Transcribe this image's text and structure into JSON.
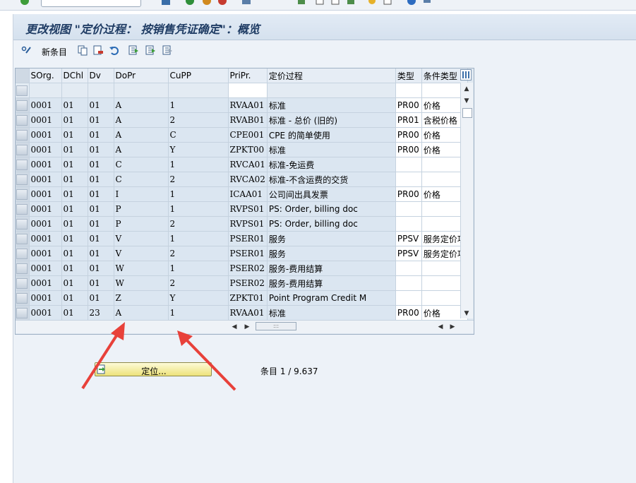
{
  "title": "更改视图 \"定价过程： 按销售凭证确定\"：概览",
  "toolbar": {
    "new_entries_label": "新条目",
    "icons": [
      "display-change-icon",
      "copy-icon",
      "delete-icon",
      "undo-icon",
      "select-all-icon",
      "select-block-icon",
      "deselect-all-icon"
    ]
  },
  "table": {
    "columns": [
      "SOrg.",
      "DChl",
      "Dv",
      "DoPr",
      "CuPP",
      "PriPr.",
      "定价过程",
      "类型",
      "条件类型"
    ],
    "rows": [
      [
        "0001",
        "01",
        "01",
        "A",
        "1",
        "RVAA01",
        "标准",
        "PR00",
        "价格"
      ],
      [
        "0001",
        "01",
        "01",
        "A",
        "2",
        "RVAB01",
        "标准 - 总价 (旧的)",
        "PR01",
        "含税价格"
      ],
      [
        "0001",
        "01",
        "01",
        "A",
        "C",
        "CPE001",
        "CPE 的简单使用",
        "PR00",
        "价格"
      ],
      [
        "0001",
        "01",
        "01",
        "A",
        "Y",
        "ZPKT00",
        "标准",
        "PR00",
        "价格"
      ],
      [
        "0001",
        "01",
        "01",
        "C",
        "1",
        "RVCA01",
        "标准-免运费",
        "",
        ""
      ],
      [
        "0001",
        "01",
        "01",
        "C",
        "2",
        "RVCA02",
        "标准-不含运费的交货",
        "",
        ""
      ],
      [
        "0001",
        "01",
        "01",
        "I",
        "1",
        "ICAA01",
        "公司间出具发票",
        "PR00",
        "价格"
      ],
      [
        "0001",
        "01",
        "01",
        "P",
        "1",
        "RVPS01",
        "PS: Order, billing doc",
        "",
        ""
      ],
      [
        "0001",
        "01",
        "01",
        "P",
        "2",
        "RVPS01",
        "PS: Order, billing doc",
        "",
        ""
      ],
      [
        "0001",
        "01",
        "01",
        "V",
        "1",
        "PSER01",
        "服务",
        "PPSV",
        "服务定价项"
      ],
      [
        "0001",
        "01",
        "01",
        "V",
        "2",
        "PSER01",
        "服务",
        "PPSV",
        "服务定价项"
      ],
      [
        "0001",
        "01",
        "01",
        "W",
        "1",
        "PSER02",
        "服务-费用结算",
        "",
        ""
      ],
      [
        "0001",
        "01",
        "01",
        "W",
        "2",
        "PSER02",
        "服务-费用结算",
        "",
        ""
      ],
      [
        "0001",
        "01",
        "01",
        "Z",
        "Y",
        "ZPKT01",
        "Point Program Credit M",
        "",
        ""
      ],
      [
        "0001",
        "01",
        "23",
        "A",
        "1",
        "RVAA01",
        "标准",
        "PR00",
        "价格"
      ]
    ]
  },
  "locate_button_label": "定位...",
  "entry_count": "条目 1 / 9.637",
  "colors": {
    "title_text": "#1f3c64",
    "annotation_arrow": "#e8413a",
    "locate_button": "#f6ee9e"
  }
}
